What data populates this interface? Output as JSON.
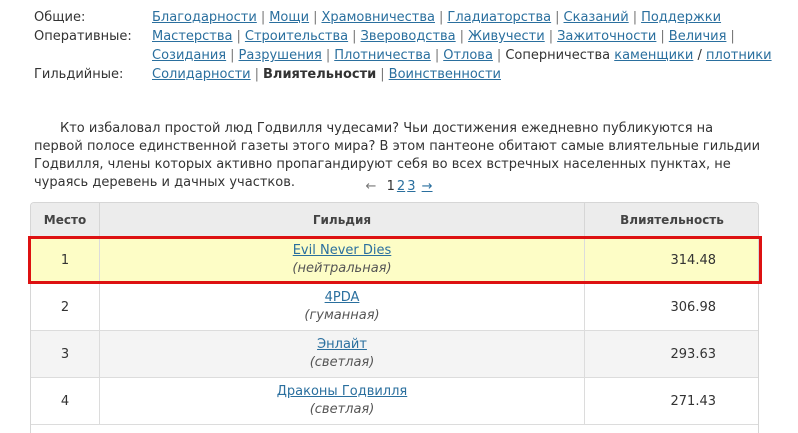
{
  "categories": [
    {
      "label": "Общие:",
      "items": [
        {
          "text": "Благодарности",
          "link": true
        },
        {
          "text": "Мощи",
          "link": true
        },
        {
          "text": "Храмовничества",
          "link": true
        },
        {
          "text": "Гладиаторства",
          "link": true
        },
        {
          "text": "Сказаний",
          "link": true
        },
        {
          "text": "Поддержки",
          "link": true
        }
      ]
    },
    {
      "label": "Оперативные:",
      "items": [
        {
          "text": "Мастерства",
          "link": true
        },
        {
          "text": "Строительства",
          "link": true
        },
        {
          "text": "Звероводства",
          "link": true
        },
        {
          "text": "Живучести",
          "link": true
        },
        {
          "text": "Зажиточности",
          "link": true
        },
        {
          "text": "Величия",
          "link": true
        },
        {
          "text": "Созидания",
          "link": true
        },
        {
          "text": "Разрушения",
          "link": true
        },
        {
          "text": "Плотничества",
          "link": true
        },
        {
          "text": "Отлова",
          "link": true
        },
        {
          "text": "Соперничества",
          "link": false,
          "inline_links": [
            "каменщики",
            "плотники"
          ]
        }
      ]
    },
    {
      "label": "Гильдийные:",
      "items": [
        {
          "text": "Солидарности",
          "link": true
        },
        {
          "text": "Влиятельности",
          "link": false,
          "current": true
        },
        {
          "text": "Воинственности",
          "link": true
        }
      ]
    }
  ],
  "intro": "Кто избаловал простой люд Годвилля чудесами? Чьи достижения ежедневно публикуются на первой полосе единственной газеты этого мира? В этом пантеоне обитают самые влиятельные гильдии Годвилля, члены которых активно пропагандируют себя во всех встречных населенных пунктах, не чураясь деревень и дачных участков.",
  "pagination": {
    "prev": "←",
    "pages": [
      "1",
      "2",
      "3"
    ],
    "current": "1",
    "next": "→"
  },
  "table": {
    "headers": {
      "place": "Место",
      "guild": "Гильдия",
      "influence": "Влиятельность"
    },
    "rows": [
      {
        "place": "1",
        "name": "Evil Never Dies",
        "alignment": "(нейтральная)",
        "value": "314.48",
        "highlighted": true
      },
      {
        "place": "2",
        "name": "4PDA",
        "alignment": "(гуманная)",
        "value": "306.98"
      },
      {
        "place": "3",
        "name": "Энлайт",
        "alignment": "(светлая)",
        "value": "293.63"
      },
      {
        "place": "4",
        "name": "Драконы Годвилля",
        "alignment": "(светлая)",
        "value": "271.43"
      }
    ]
  },
  "colors": {
    "link": "#2a6f9e",
    "highlight_bg": "#fdfdc6",
    "highlight_border": "#dd1111"
  }
}
